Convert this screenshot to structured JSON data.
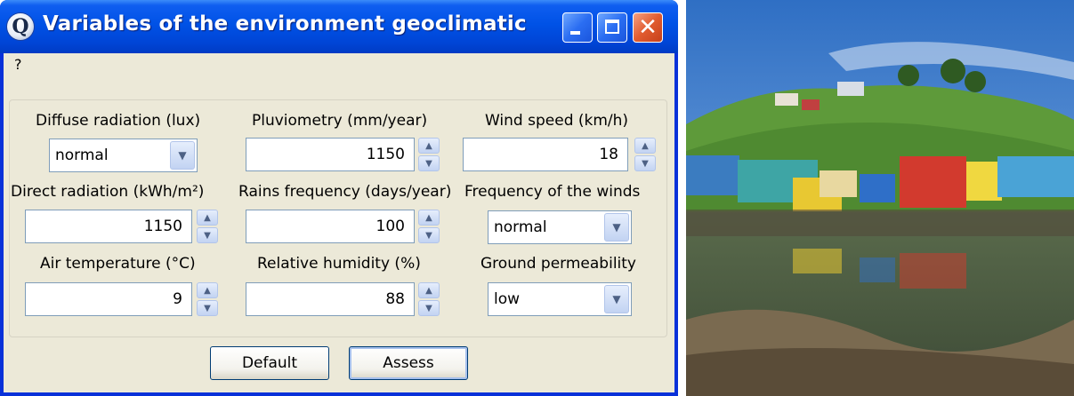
{
  "window": {
    "title": "Variables of the environment geoclimatic",
    "icon_letter": "Q",
    "menu_help": "?"
  },
  "fields": {
    "diffuse_radiation": {
      "label": "Diffuse radiation (lux)",
      "value": "normal"
    },
    "pluviometry": {
      "label": "Pluviometry (mm/year)",
      "value": "1150"
    },
    "wind_speed": {
      "label": "Wind speed (km/h)",
      "value": "18"
    },
    "direct_radiation": {
      "label": "Direct radiation (kWh/m²)",
      "value": "1150"
    },
    "rains_frequency": {
      "label": "Rains frequency (days/year)",
      "value": "100"
    },
    "winds_frequency": {
      "label": "Frequency of the winds",
      "value": "normal"
    },
    "air_temperature": {
      "label": "Air temperature (°C)",
      "value": "9"
    },
    "relative_humidity": {
      "label": "Relative humidity (%)",
      "value": "88"
    },
    "ground_permeability": {
      "label": "Ground permeability",
      "value": "low"
    }
  },
  "buttons": {
    "default": "Default",
    "assess": "Assess"
  },
  "colors": {
    "titlebar": "#0052e6",
    "window_face": "#ece9d8",
    "close_button": "#e15c2f"
  }
}
